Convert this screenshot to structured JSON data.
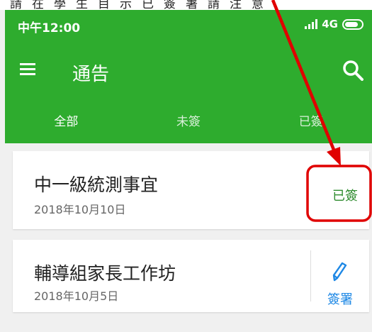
{
  "caption_text": "請在學生目示已簽署請注意",
  "status_bar": {
    "time": "中午12:00",
    "network": "4G",
    "signal_icon": "signal-icon",
    "battery_icon": "battery-icon"
  },
  "toolbar": {
    "title": "通告",
    "menu_icon": "menu-icon",
    "search_icon": "search-icon"
  },
  "tabs": [
    {
      "label": "全部",
      "active": true
    },
    {
      "label": "未簽",
      "active": false
    },
    {
      "label": "已簽",
      "active": false
    }
  ],
  "notices": [
    {
      "title": "中一級統測事宜",
      "date": "2018年10月10日",
      "status": "已簽"
    },
    {
      "title": "輔導組家長工作坊",
      "date": "2018年10月5日",
      "action": "簽署",
      "action_icon": "pen-icon"
    }
  ],
  "colors": {
    "appbar": "#2eac2e",
    "signed_text": "#2e8b2e",
    "action_blue": "#1e88e5",
    "annotation_red": "#e00000"
  }
}
